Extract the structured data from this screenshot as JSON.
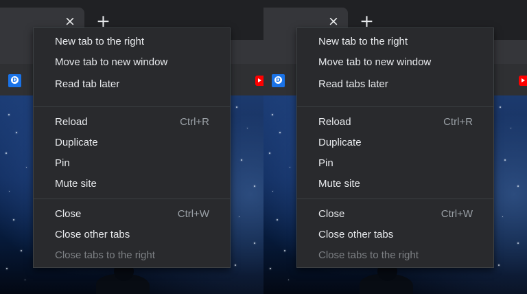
{
  "colors": {
    "frame": "#202124",
    "active_tab": "#35363a",
    "menu_background": "#292a2d",
    "menu_text": "#e8eaed",
    "shortcut_text": "#9aa0a6",
    "disabled_text": "#7d8084",
    "separator": "#3c4043"
  },
  "icons": {
    "tab_close": "×",
    "new_tab": "+",
    "bookmark_left": "blue-d-icon",
    "bookmark_right": "youtube-icon"
  },
  "panels": [
    {
      "context_menu": {
        "items": [
          {
            "label": "New tab to the right",
            "shortcut": "",
            "enabled": true
          },
          {
            "label": "Move tab to new window",
            "shortcut": "",
            "enabled": true
          },
          {
            "label": "Read tab later",
            "shortcut": "",
            "enabled": true
          },
          {
            "label": "Reload",
            "shortcut": "Ctrl+R",
            "enabled": true
          },
          {
            "label": "Duplicate",
            "shortcut": "",
            "enabled": true
          },
          {
            "label": "Pin",
            "shortcut": "",
            "enabled": true
          },
          {
            "label": "Mute site",
            "shortcut": "",
            "enabled": true
          },
          {
            "label": "Close",
            "shortcut": "Ctrl+W",
            "enabled": true
          },
          {
            "label": "Close other tabs",
            "shortcut": "",
            "enabled": true
          },
          {
            "label": "Close tabs to the right",
            "shortcut": "",
            "enabled": false
          }
        ]
      }
    },
    {
      "context_menu": {
        "items": [
          {
            "label": "New tab to the right",
            "shortcut": "",
            "enabled": true
          },
          {
            "label": "Move tab to new window",
            "shortcut": "",
            "enabled": true
          },
          {
            "label": "Read tabs later",
            "shortcut": "",
            "enabled": true
          },
          {
            "label": "Reload",
            "shortcut": "Ctrl+R",
            "enabled": true
          },
          {
            "label": "Duplicate",
            "shortcut": "",
            "enabled": true
          },
          {
            "label": "Pin",
            "shortcut": "",
            "enabled": true
          },
          {
            "label": "Mute site",
            "shortcut": "",
            "enabled": true
          },
          {
            "label": "Close",
            "shortcut": "Ctrl+W",
            "enabled": true
          },
          {
            "label": "Close other tabs",
            "shortcut": "",
            "enabled": true
          },
          {
            "label": "Close tabs to the right",
            "shortcut": "",
            "enabled": false
          }
        ]
      }
    }
  ]
}
